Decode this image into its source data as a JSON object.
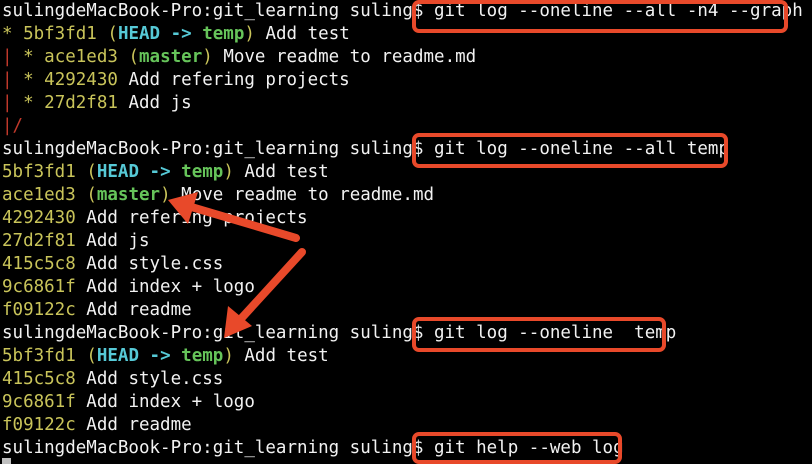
{
  "prompt": "sulingdeMacBook-Pro:git_learning suling$",
  "commands": [
    "git log --oneline --all -n4 --graph",
    "git log --oneline --all temp",
    "git log --oneline  temp",
    "git help --web log"
  ],
  "graph_output": [
    {
      "graph": "* ",
      "hash": "5bf3fd1",
      "head": "HEAD -> ",
      "branch": "temp",
      "msg": " Add test"
    },
    {
      "graph": "| * ",
      "hash": "ace1ed3",
      "head": "",
      "branch": "master",
      "msg": " Move readme to readme.md"
    },
    {
      "graph": "| * ",
      "hash": "4292430",
      "msg": " Add refering projects"
    },
    {
      "graph": "| * ",
      "hash": "27d2f81",
      "msg": " Add js"
    },
    {
      "graph": "|/"
    }
  ],
  "all_temp_output": [
    {
      "hash": "5bf3fd1",
      "head": "HEAD -> ",
      "branch": "temp",
      "msg": " Add test"
    },
    {
      "hash": "ace1ed3",
      "head": "",
      "branch": "master",
      "msg": " Move readme to readme.md"
    },
    {
      "hash": "4292430",
      "msg": " Add refering projects"
    },
    {
      "hash": "27d2f81",
      "msg": " Add js"
    },
    {
      "hash": "415c5c8",
      "msg": " Add style.css"
    },
    {
      "hash": "9c6861f",
      "msg": " Add index + logo"
    },
    {
      "hash": "f09122c",
      "msg": " Add readme"
    }
  ],
  "temp_output": [
    {
      "hash": "5bf3fd1",
      "head": "HEAD -> ",
      "branch": "temp",
      "msg": " Add test"
    },
    {
      "hash": "415c5c8",
      "msg": " Add style.css"
    },
    {
      "hash": "9c6861f",
      "msg": " Add index + logo"
    },
    {
      "hash": "f09122c",
      "msg": " Add readme"
    }
  ],
  "annotation_color": "#e8492a"
}
